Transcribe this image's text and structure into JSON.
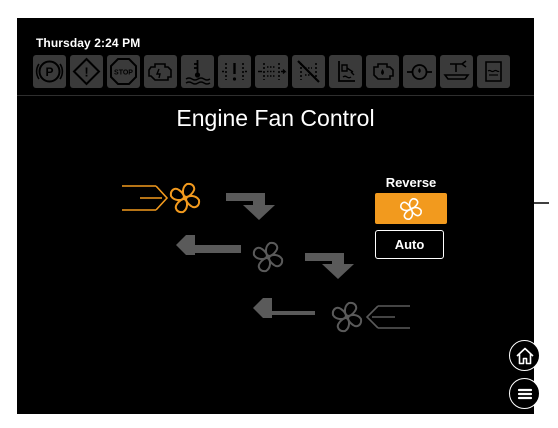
{
  "status_bar": {
    "datetime": "Thursday 2:24 PM"
  },
  "toolbar_icons": [
    {
      "name": "park-brake-icon",
      "label": "P"
    },
    {
      "name": "warning-icon",
      "label": "!"
    },
    {
      "name": "stop-icon",
      "label": "STOP"
    },
    {
      "name": "engine-icon"
    },
    {
      "name": "coolant-temp-icon"
    },
    {
      "name": "dpf-regen-icon"
    },
    {
      "name": "dpf-filter-icon"
    },
    {
      "name": "regen-inhibit-icon"
    },
    {
      "name": "def-level-icon"
    },
    {
      "name": "engine-oil-icon"
    },
    {
      "name": "oil-pressure-icon"
    },
    {
      "name": "transmission-icon"
    },
    {
      "name": "fuel-water-icon"
    }
  ],
  "page": {
    "title": "Engine Fan Control"
  },
  "fan_mode": {
    "label": "Reverse",
    "reverse_button_icon": "fan-icon",
    "auto_label": "Auto",
    "selected": "Reverse"
  },
  "nav": {
    "home_icon": "home-icon",
    "menu_icon": "menu-icon"
  },
  "colors": {
    "accent": "#f29a1e",
    "screen_bg": "#000000",
    "inactive_icon": "#3a3a3a",
    "diagram_gray": "#5a5a5a"
  }
}
